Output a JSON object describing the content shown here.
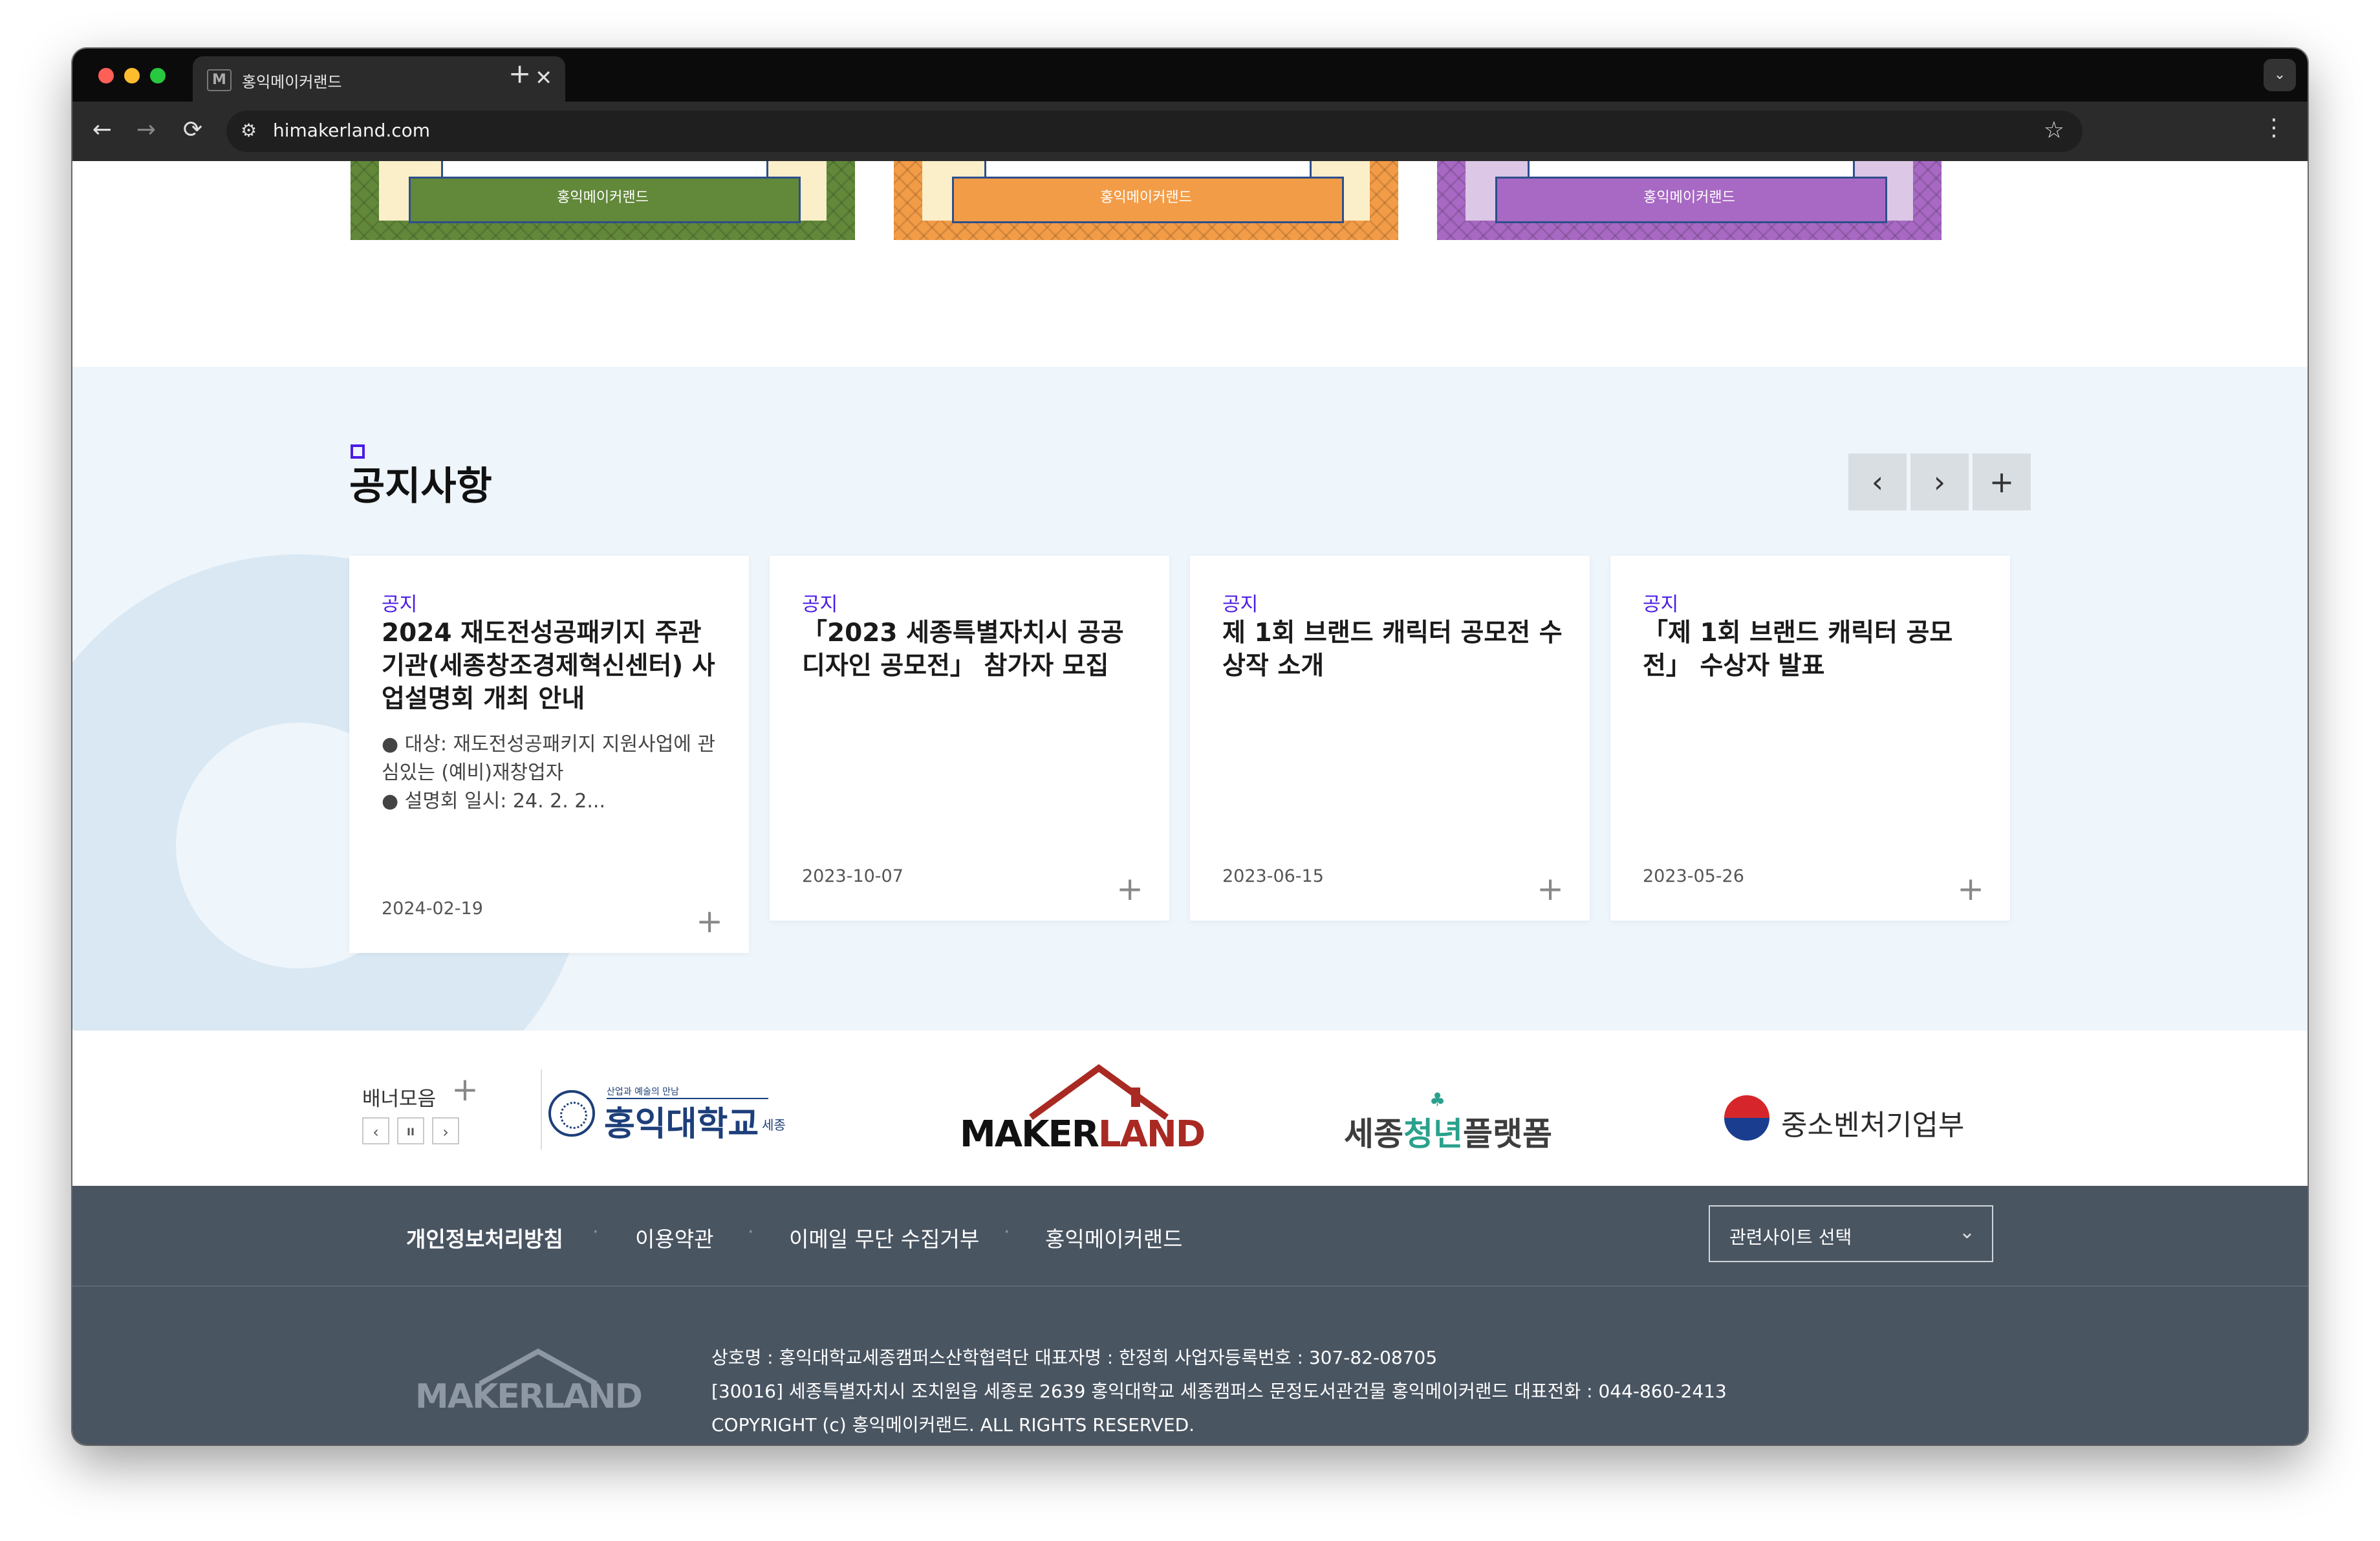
{
  "browser": {
    "tab_title": "홍익메이커랜드",
    "favicon_letter": "M",
    "url": "himakerland.com",
    "controls": {
      "back": "←",
      "forward": "→",
      "reload": "⟳",
      "close": "✕",
      "new_tab": "+",
      "star": "☆",
      "menu": "⋮",
      "dropdown": "⌄",
      "site_info": "⚙"
    }
  },
  "top_banners": [
    {
      "label": "홍익메이커랜드",
      "color": "#62883a",
      "accent": "#fbefc9"
    },
    {
      "label": "홍익메이커랜드",
      "color": "#f39c47",
      "accent": "#fbefc9"
    },
    {
      "label": "홍익메이커랜드",
      "color": "#a769c3",
      "accent": "#dcc7e6"
    }
  ],
  "notice": {
    "title": "공지사항",
    "nav": {
      "prev": "‹",
      "next": "›",
      "more": "+"
    },
    "cards": [
      {
        "category": "공지",
        "title": "2024 재도전성공패키지 주관기관(세종창조경제혁신센터) 사업설명회 개최 안내",
        "desc_lines": [
          "● 대상: 재도전성공패키지 지원사업에 관심있는 (예비)재창업자",
          "● 설명회 일시: 24. 2. 2..."
        ],
        "date": "2024-02-19"
      },
      {
        "category": "공지",
        "title": "「2023 세종특별자치시 공공디자인 공모전」 참가자 모집",
        "date": "2023-10-07"
      },
      {
        "category": "공지",
        "title": "제 1회 브랜드 캐릭터 공모전 수상작 소개",
        "date": "2023-06-15"
      },
      {
        "category": "공지",
        "title": "「제 1회 브랜드 캐릭터 공모전」 수상자 발표",
        "date": "2023-05-26"
      }
    ],
    "card_more": "+"
  },
  "banner_row": {
    "label": "배너모음",
    "more": "+",
    "controls": {
      "prev": "‹",
      "pause": "II",
      "next": "›"
    },
    "logos": {
      "hongik": {
        "tag": "산업과 예술의 만남",
        "name": "홍익대학교",
        "campus": "세종"
      },
      "makerland": {
        "a": "MAKER",
        "b": "LAND"
      },
      "youth": {
        "a": "세종",
        "b": "청년",
        "c": "플랫폼"
      },
      "mss": {
        "name": "중소벤처기업부"
      }
    }
  },
  "footer": {
    "links": [
      "개인정보처리방침",
      "이용약관",
      "이메일 무단 수집거부",
      "홍익메이커랜드"
    ],
    "select_label": "관련사이트 선택",
    "select_chevron": "⌄",
    "logo": {
      "a": "MAKER",
      "b": "LAND"
    },
    "info": [
      "상호명 : 홍익대학교세종캠퍼스산학협력단    대표자명 : 한정희    사업자등록번호 : 307-82-08705",
      "[30016] 세종특별자치시 조치원읍 세종로 2639 홍익대학교 세종캠퍼스 문정도서관건물 홍익메이커랜드    대표전화 : 044-860-2413",
      "COPYRIGHT (c) 홍익메이커랜드. ALL RIGHTS RESERVED."
    ]
  },
  "colors": {
    "accent": "#4b1be6",
    "section_bg": "#eef5fb",
    "footer_bg": "#4a5562",
    "traffic_red": "#fe5f57",
    "traffic_yellow": "#febc2e",
    "traffic_green": "#28c840"
  }
}
